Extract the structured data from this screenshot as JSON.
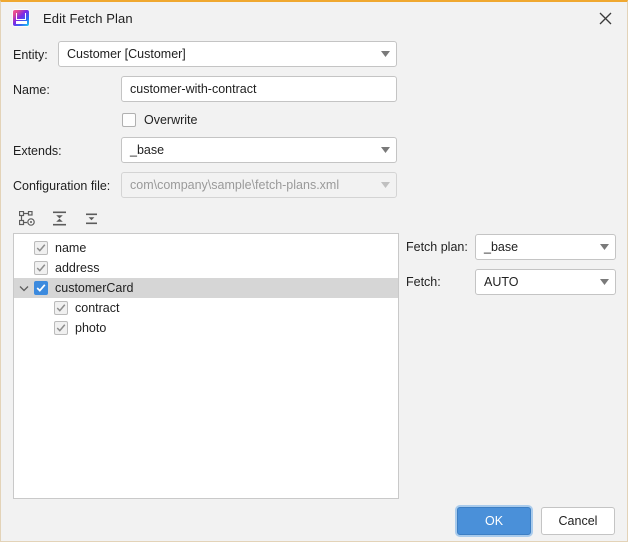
{
  "window": {
    "title": "Edit Fetch Plan",
    "app_icon": "intellij-idea-icon",
    "close_icon": "close-icon",
    "accent_top_border": "#f0a830",
    "border_color": "#e3d3b8",
    "background": "#f2f2f2"
  },
  "form": {
    "entity": {
      "label": "Entity:",
      "value": "Customer [Customer]",
      "enabled": true
    },
    "name": {
      "label": "Name:",
      "value": "customer-with-contract",
      "placeholder": "",
      "enabled": true
    },
    "overwrite": {
      "label": "Overwrite",
      "checked": false
    },
    "extends": {
      "label": "Extends:",
      "value": "_base",
      "enabled": true
    },
    "configuration_file": {
      "label": "Configuration file:",
      "value": "com\\company\\sample\\fetch-plans.xml",
      "enabled": false
    }
  },
  "toolbar": {
    "buttons": [
      {
        "name": "edit-structure-button",
        "icon": "structure-settings-icon",
        "tooltip": ""
      },
      {
        "name": "expand-all-button",
        "icon": "expand-all-icon",
        "tooltip": ""
      },
      {
        "name": "collapse-all-button",
        "icon": "collapse-all-icon",
        "tooltip": ""
      }
    ]
  },
  "tree": {
    "rows": [
      {
        "label": "name",
        "indent": 1,
        "checked": true,
        "checkstyle": "gray",
        "expandable": false,
        "expanded": false,
        "selected": false
      },
      {
        "label": "address",
        "indent": 1,
        "checked": true,
        "checkstyle": "gray",
        "expandable": false,
        "expanded": false,
        "selected": false
      },
      {
        "label": "customerCard",
        "indent": 0,
        "checked": true,
        "checkstyle": "blue",
        "expandable": true,
        "expanded": true,
        "selected": true
      },
      {
        "label": "contract",
        "indent": 2,
        "checked": true,
        "checkstyle": "gray",
        "expandable": false,
        "expanded": false,
        "selected": false
      },
      {
        "label": "photo",
        "indent": 2,
        "checked": true,
        "checkstyle": "gray",
        "expandable": false,
        "expanded": false,
        "selected": false
      }
    ]
  },
  "details": {
    "fetch_plan": {
      "label": "Fetch plan:",
      "value": "_base"
    },
    "fetch": {
      "label": "Fetch:",
      "value": "AUTO"
    }
  },
  "footer": {
    "ok_label": "OK",
    "cancel_label": "Cancel",
    "ok_color": "#4a90d9"
  }
}
